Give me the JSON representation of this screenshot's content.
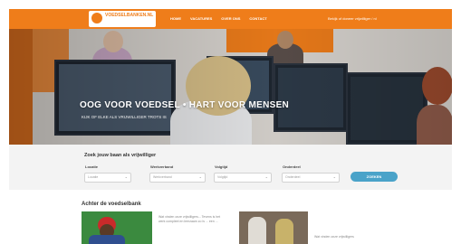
{
  "header": {
    "logo_name": "VOEDSELBANKEN.NL",
    "logo_tagline": "",
    "nav": [
      "HOME",
      "VACATURES",
      "OVER ONS",
      "CONTACT"
    ],
    "right_link": "Bekijk of doneer vrijwilliger / nl"
  },
  "hero": {
    "title": "OOG VOOR VOEDSEL • HART VOOR MENSEN",
    "subtitle": "KIJK OF ELKE ALS VRIJWILLIGER TROTS IS"
  },
  "search": {
    "title": "Zoek jouw baan als vrijwilliger",
    "fields": [
      {
        "label": "Locatie",
        "value": "Locatie"
      },
      {
        "label": "Werkverband",
        "value": "Werkverband"
      },
      {
        "label": "Volgtijd",
        "value": "Volgtijd"
      },
      {
        "label": "Onderdeel",
        "value": "Onderdeel"
      }
    ],
    "button_label": "ZOEKEN"
  },
  "lower": {
    "title": "Achter de voedselbank",
    "card1_text": "Wat vinden onze vrijwilligers... Tevens is het werk compleet en leerzaam zo is ... een ...",
    "card2_text": "Wat vinden onze vrijwilligers"
  },
  "colors": {
    "brand_orange": "#ef7d1a",
    "button_blue": "#4aa3c9"
  }
}
